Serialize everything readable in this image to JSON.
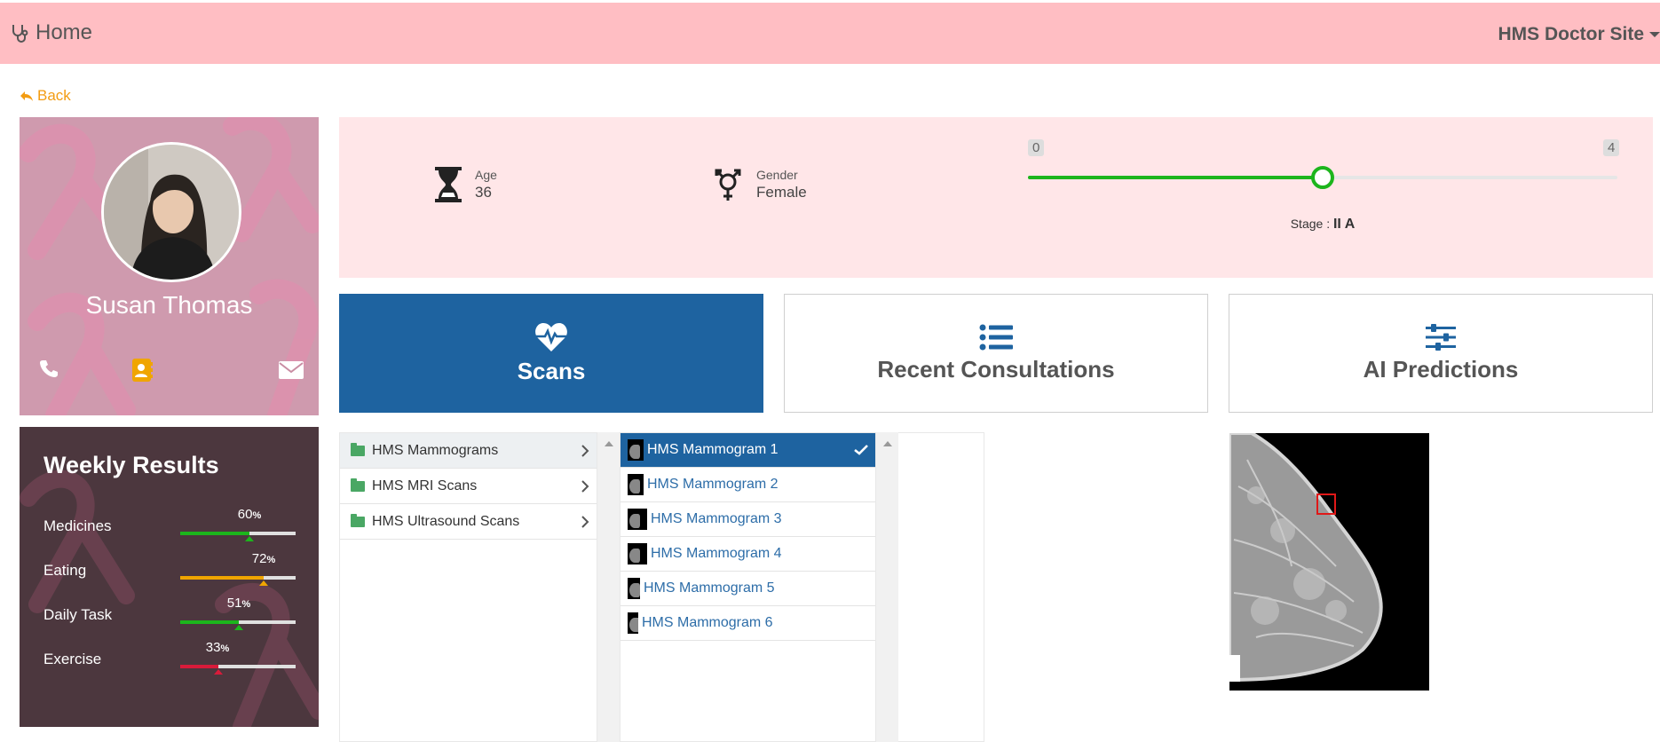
{
  "navbar": {
    "home_label": "Home",
    "home_icon": "stethoscope-icon",
    "site_label": "HMS Doctor Site",
    "bg_color": "#ffbec3"
  },
  "back": {
    "label": "Back",
    "icon": "reply-arrow-icon",
    "color": "#f39c12"
  },
  "patient": {
    "name": "Susan Thomas",
    "actions": [
      "phone-icon",
      "contact-book-icon",
      "envelope-icon"
    ],
    "age_label": "Age",
    "age": "36",
    "gender_label": "Gender",
    "gender": "Female",
    "stage": {
      "min_label": "0",
      "max_label": "4",
      "value": 2,
      "min": 0,
      "max": 4,
      "prefix": "Stage : ",
      "text": "II A"
    }
  },
  "weekly": {
    "title": "Weekly Results",
    "unit": "%",
    "items": [
      {
        "label": "Medicines",
        "value": "60",
        "color": "#1cb51c"
      },
      {
        "label": "Eating",
        "value": "72",
        "color": "#f0a500"
      },
      {
        "label": "Daily Task",
        "value": "51",
        "color": "#1cb51c"
      },
      {
        "label": "Exercise",
        "value": "33",
        "color": "#d81b3a"
      }
    ]
  },
  "tabs": [
    {
      "label": "Scans",
      "icon": "heartbeat-icon",
      "active": true
    },
    {
      "label": "Recent Consultations",
      "icon": "list-icon",
      "active": false
    },
    {
      "label": "AI Predictions",
      "icon": "sliders-icon",
      "active": false
    }
  ],
  "folders": [
    {
      "label": "HMS Mammograms",
      "selected": true
    },
    {
      "label": "HMS MRI Scans",
      "selected": false
    },
    {
      "label": "HMS Ultrasound Scans",
      "selected": false
    }
  ],
  "scans": [
    {
      "label": "HMS Mammogram 1",
      "active": true
    },
    {
      "label": "HMS Mammogram 2",
      "active": false
    },
    {
      "label": "HMS Mammogram 3",
      "active": false
    },
    {
      "label": "HMS Mammogram 4",
      "active": false
    },
    {
      "label": "HMS Mammogram 5",
      "active": false
    },
    {
      "label": "HMS Mammogram 6",
      "active": false
    }
  ],
  "colors": {
    "primary": "#1e63a0",
    "info_bg": "#ffe6e8",
    "slider": "#1cb51c"
  }
}
